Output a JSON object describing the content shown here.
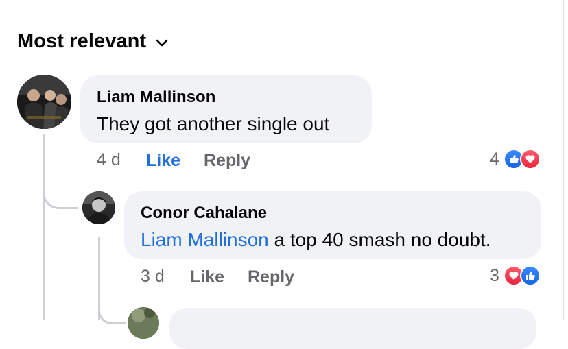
{
  "sort": {
    "label": "Most relevant"
  },
  "comments": [
    {
      "author": "Liam Mallinson",
      "text": "They got another single out",
      "time": "4 d",
      "like_label": "Like",
      "reply_label": "Reply",
      "reaction_count": "4",
      "reactions": [
        "like-icon",
        "love-icon"
      ]
    },
    {
      "author": "Conor Cahalane",
      "mention": "Liam Mallinson",
      "text": " a top 40 smash no doubt.",
      "time": "3 d",
      "like_label": "Like",
      "reply_label": "Reply",
      "reaction_count": "3",
      "reactions": [
        "love-icon",
        "like-icon"
      ]
    }
  ],
  "colors": {
    "link_blue": "#216fdb",
    "bubble_bg": "#f0f2f5",
    "meta_gray": "#65676b",
    "thread_line": "#ccd0d5"
  }
}
